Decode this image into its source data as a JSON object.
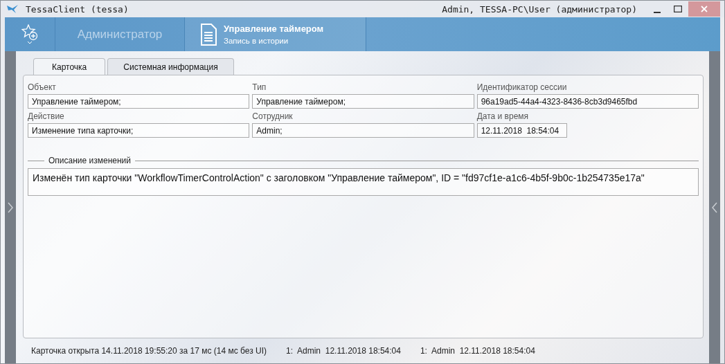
{
  "window": {
    "title": "TessaClient (tessa)",
    "user": "Admin, TESSA-PC\\User (администратор)"
  },
  "header": {
    "workplace": "Администратор",
    "card": {
      "title": "Управление таймером",
      "subtitle": "Запись в истории"
    }
  },
  "tabs": [
    {
      "label": "Карточка",
      "selected": true
    },
    {
      "label": "Системная информация",
      "selected": false
    }
  ],
  "fields": [
    {
      "label": "Объект",
      "value": "Управление таймером;"
    },
    {
      "label": "Тип",
      "value": "Управление таймером;"
    },
    {
      "label": "Идентификатор сессии",
      "value": "96a19ad5-44a4-4323-8436-8cb3d9465fbd"
    },
    {
      "label": "Действие",
      "value": "Изменение типа карточки;"
    },
    {
      "label": "Сотрудник",
      "value": "Admin;"
    },
    {
      "label": "Дата и время",
      "value": "12.11.2018  18:54:04"
    }
  ],
  "description": {
    "title": "Описание изменений",
    "value": "Изменён тип карточки \"WorkflowTimerControlAction\" с заголовком \"Управление таймером\", ID = \"fd97cf1e-a1c6-4b5f-9b0c-1b254735e17a\""
  },
  "status_bar": [
    "Карточка открыта 14.11.2018 19:55:20 за 17 мс (14 мс без UI)",
    "1:  Admin  12.11.2018 18:54:04",
    "1:  Admin  12.11.2018 18:54:04"
  ]
}
